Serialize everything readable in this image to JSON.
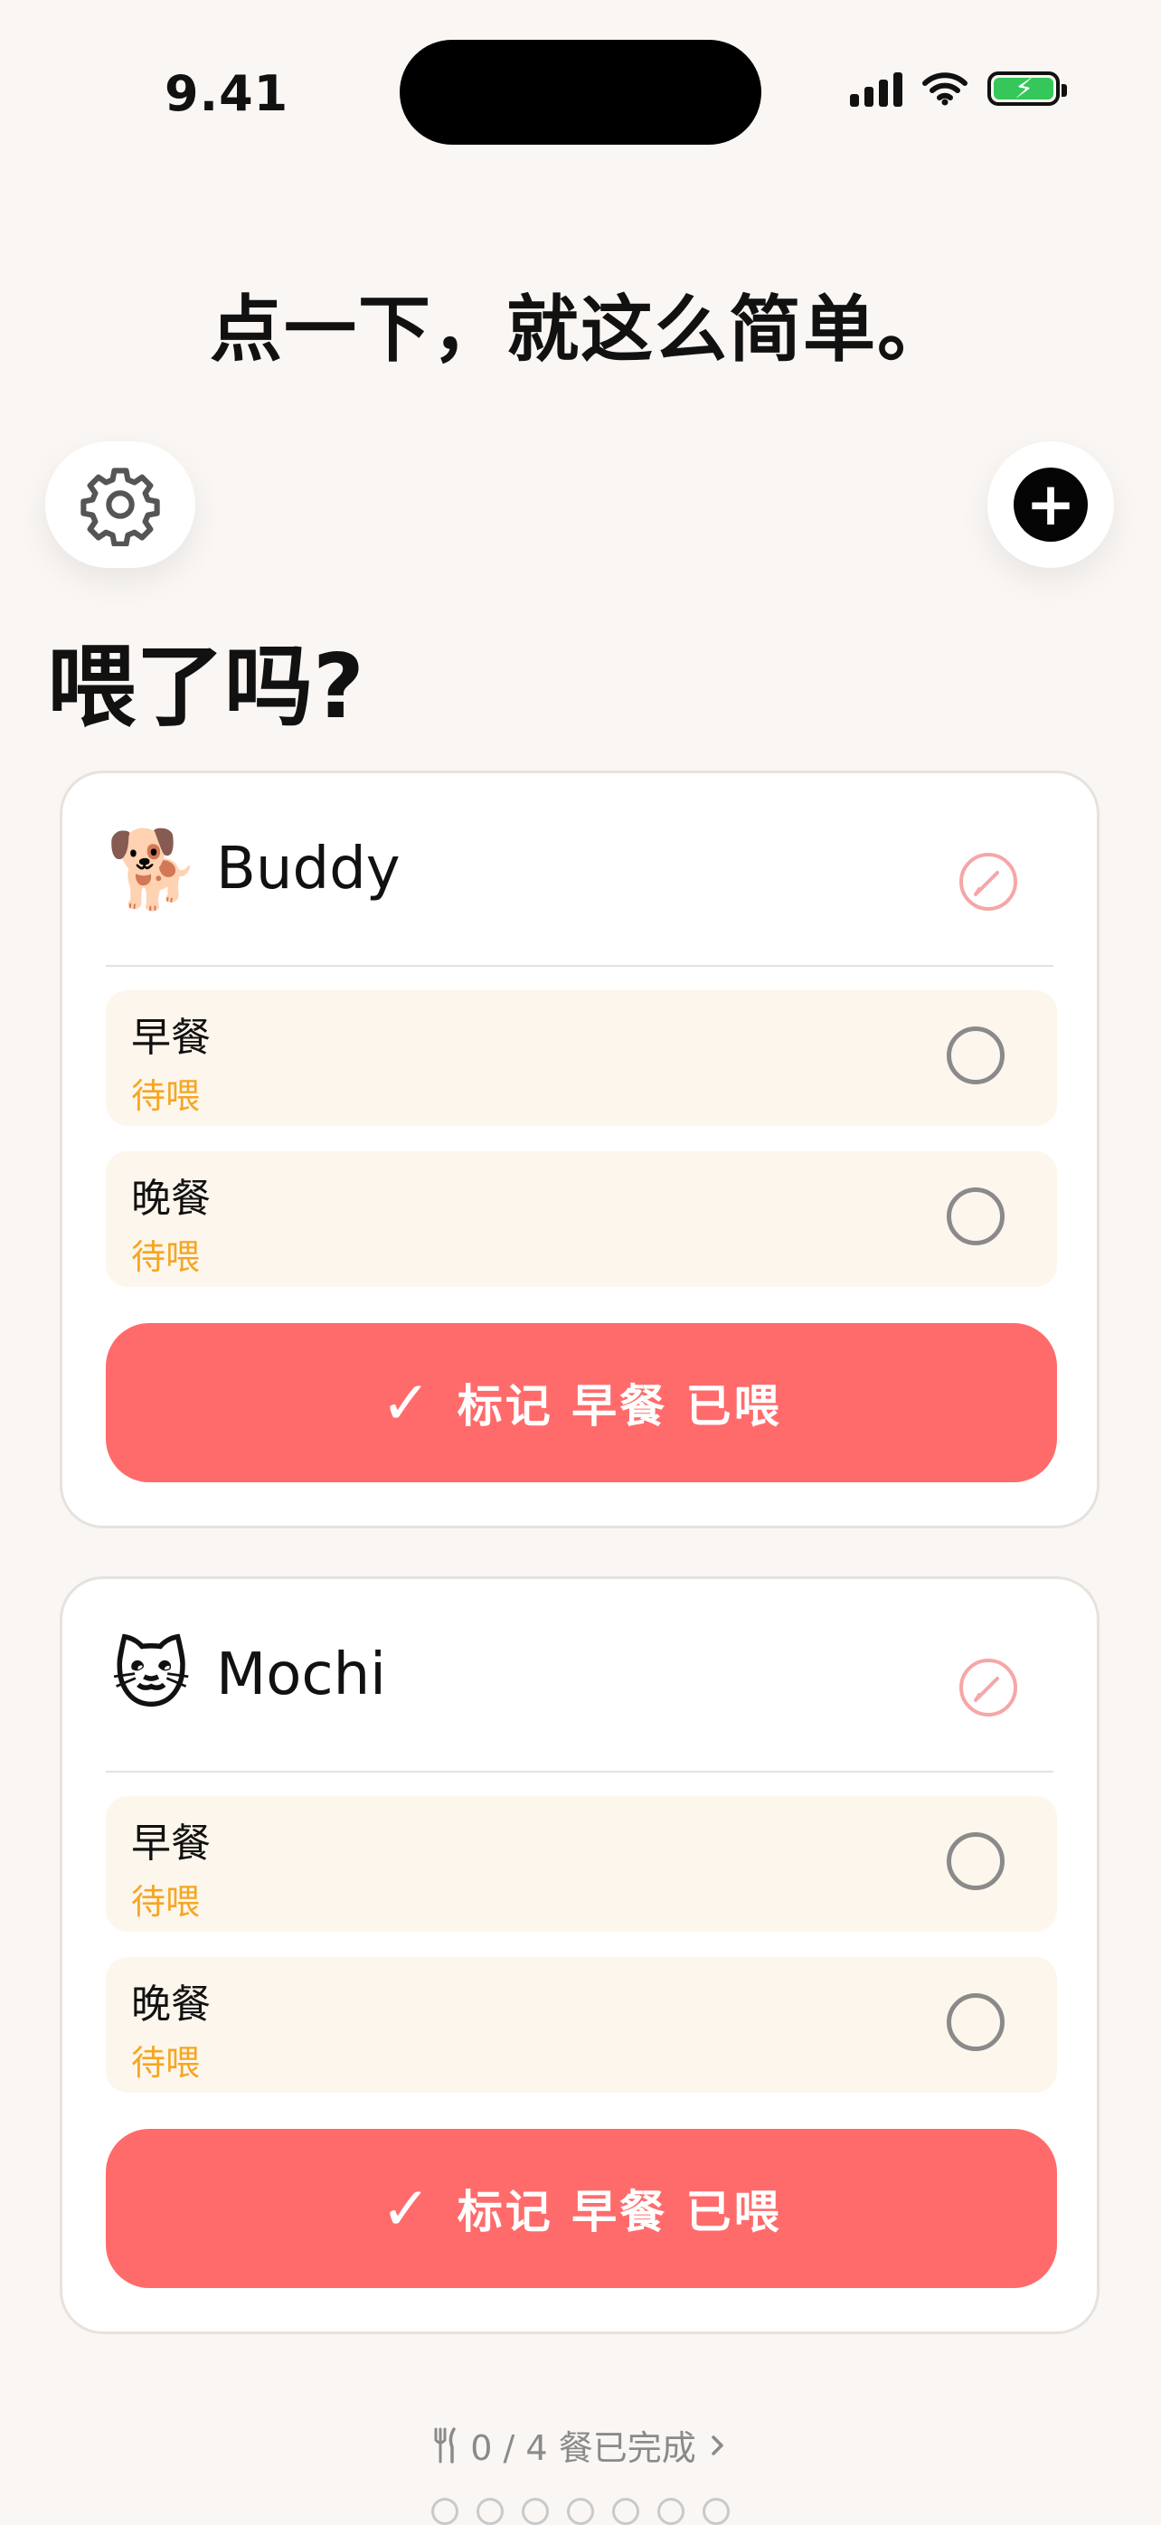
{
  "status_bar": {
    "time": "9.41",
    "icons": [
      "cellular-signal-icon",
      "wifi-icon",
      "battery-charging-icon"
    ]
  },
  "tagline": "点一下，就这么简单。",
  "toolbar": {
    "settings_icon": "gear-icon",
    "add_icon": "plus-circle-icon"
  },
  "page_title": "喂了吗?",
  "pets": [
    {
      "emoji": "🐕",
      "name": "Buddy",
      "meals": [
        {
          "name": "早餐",
          "status": "待喂"
        },
        {
          "name": "晚餐",
          "status": "待喂"
        }
      ],
      "mark_button": "标记 早餐 已喂"
    },
    {
      "emoji": "🐱",
      "name": "Mochi",
      "meals": [
        {
          "name": "早餐",
          "status": "待喂"
        },
        {
          "name": "晚餐",
          "status": "待喂"
        }
      ],
      "mark_button": "标记 早餐 已喂"
    }
  ],
  "progress": {
    "text": "0 / 4 餐已完成",
    "icon": "fork-knife-icon",
    "chevron": "chevron-right-icon"
  },
  "colors": {
    "accent": "#ff6b6b",
    "pending": "#f5a623",
    "meal_row_bg": "#fdf6ec",
    "background": "#f9f6f3"
  }
}
